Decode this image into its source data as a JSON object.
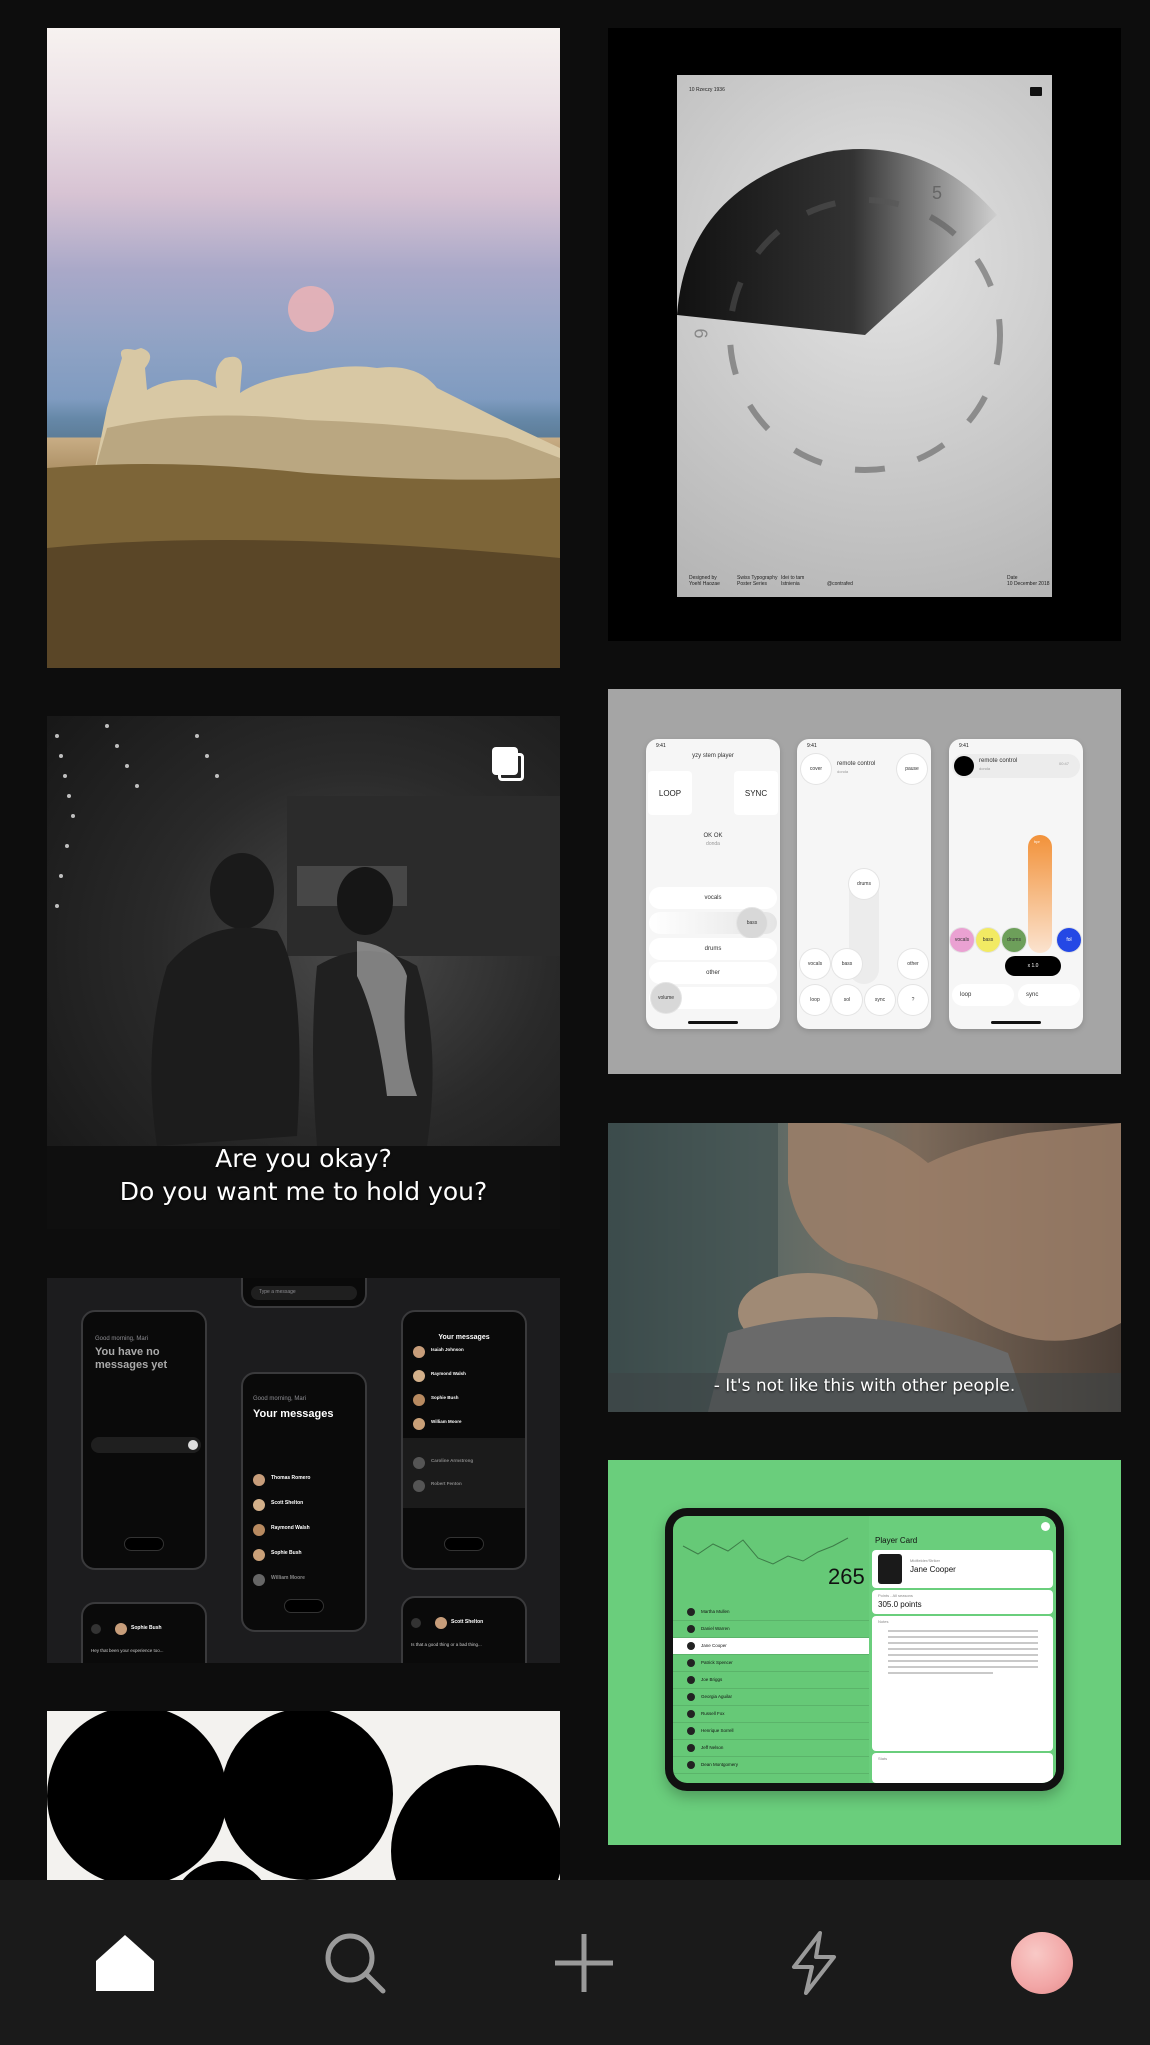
{
  "colors": {
    "background": "#0d0d0d",
    "nav_background": "#1a1a1a",
    "nav_icon_active": "#ffffff",
    "nav_icon_inactive": "#9a9a9a",
    "profile_avatar": "#f2a6a6",
    "card_green": "#6ace7c"
  },
  "tiles": {
    "film_still_1": {
      "subtitle_line1": "Are you okay?",
      "subtitle_line2": "Do you want me to hold you?",
      "multi_icon": "stack-icon"
    },
    "film_still_2": {
      "subtitle": "- It's not like this with other people."
    },
    "poster": {
      "header_left": "10 Rzeczy 1936",
      "number_top": "5",
      "number_left": "6",
      "footer_cols": [
        "Designed by\nYoehl Haozae",
        "Swiss Typography\nPoster Series",
        "Idei to tam\nIstnienia",
        "@contrafed",
        "Date\n10 December 2018"
      ]
    },
    "stem_player": {
      "time": "9:41",
      "screen1_title": "yzy stem player",
      "loop": "LOOP",
      "sync": "SYNC",
      "track": "OK OK",
      "artist": "donda",
      "stems": [
        "vocals",
        "bass",
        "drums",
        "other",
        "volume"
      ],
      "screen2_cover": "cover",
      "screen2_title": "remote control",
      "screen2_sub": "donda",
      "screen2_pause": "pause",
      "screen2_drums": "drums",
      "screen2_row": [
        "vocals",
        "bass",
        "other"
      ],
      "screen2_bottom": [
        "loop",
        "sol",
        "sync",
        "?"
      ],
      "screen3_title": "remote control",
      "screen3_sub": "donda",
      "screen3_time": "00:47",
      "screen3_fader": "hpr",
      "screen3_pads": [
        "vocals",
        "bass",
        "drums",
        "fol"
      ],
      "screen3_pill": "x 1.0",
      "screen3_bottom": [
        "loop",
        "sync"
      ]
    },
    "messages": {
      "greeting": "Good morning, Mari",
      "empty_title": "You have no\nmessages yet",
      "search_placeholder": "Type a message",
      "title": "Your messages",
      "contacts": [
        "Thomas Romero",
        "Scott Shelton",
        "Raymond Walsh",
        "Sophie Bush",
        "William Moore"
      ],
      "contact_sub": "2 days in advance",
      "right_title": "Your messages",
      "right_contacts": [
        "Isaiah Johnson",
        "Raymond Walsh",
        "Sophie Bush",
        "William Moore"
      ],
      "right_contacts_2": [
        "Caroline Armstrong",
        "Robert Fenton"
      ],
      "chat_left_name": "Sophie Bush",
      "chat_left_text": "Hey that been your experience too...",
      "chat_right_name": "Scott Shelton",
      "chat_right_text": "Is that a good thing or a bad thing..."
    },
    "player_card": {
      "panel_title": "Player Card",
      "player_label": "Midfielder/Striker",
      "player_name": "Jane Cooper",
      "score_big": "265",
      "points_label": "Points - All seasons",
      "points": "305.0 points",
      "notes_label": "Notes",
      "stats_label": "Stats",
      "roster": [
        "Martha Mullen",
        "Daniel Warren",
        "Jane Cooper",
        "Patrick Spencer",
        "Joe Briggs",
        "Georgia Aguilar",
        "Russell Fox",
        "Henrique Sorrell",
        "Jeff Nelson",
        "Dean Montgomery"
      ]
    }
  },
  "nav": {
    "items": [
      {
        "name": "home",
        "icon": "home-icon",
        "active": true
      },
      {
        "name": "search",
        "icon": "search-icon",
        "active": false
      },
      {
        "name": "create",
        "icon": "plus-icon",
        "active": false
      },
      {
        "name": "activity",
        "icon": "lightning-icon",
        "active": false
      },
      {
        "name": "profile",
        "icon": "avatar",
        "active": false
      }
    ]
  }
}
